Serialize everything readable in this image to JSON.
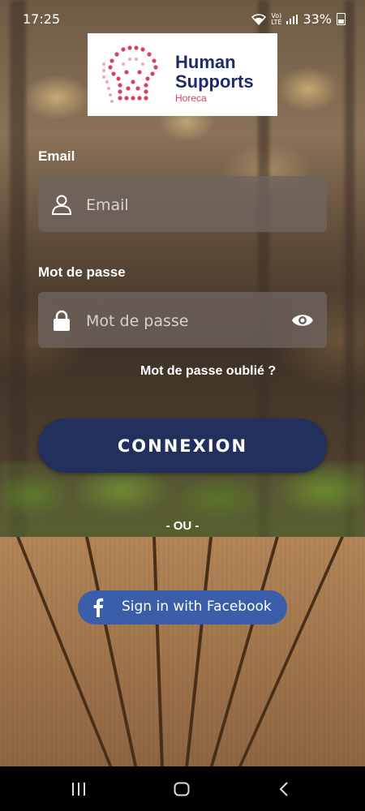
{
  "status_bar": {
    "time": "17:25",
    "volte_line1": "Vo)",
    "volte_line2": "LTE",
    "battery": "33%"
  },
  "logo": {
    "line1": "Human",
    "line2": "Supports",
    "line3": "Horeca",
    "colors": {
      "navy": "#1f2a6b",
      "accent": "#d94060"
    }
  },
  "form": {
    "email_label": "Email",
    "email_placeholder": "Email",
    "email_icon": "user-icon",
    "password_label": "Mot de passe",
    "password_placeholder": "Mot de passe",
    "password_icon": "lock-icon",
    "visibility_icon": "eye-icon",
    "forgot_password": "Mot de passe oublié ?",
    "submit_label": "CONNEXION"
  },
  "separator": "- OU -",
  "facebook": {
    "label": "Sign in with Facebook",
    "icon": "facebook-icon",
    "color": "#3b5eab"
  },
  "nav": {
    "recents": "recents-icon",
    "home": "home-icon",
    "back": "back-icon"
  },
  "colors": {
    "primary_button": "#232f5c",
    "input_bg": "rgba(110,100,95,0.78)"
  }
}
